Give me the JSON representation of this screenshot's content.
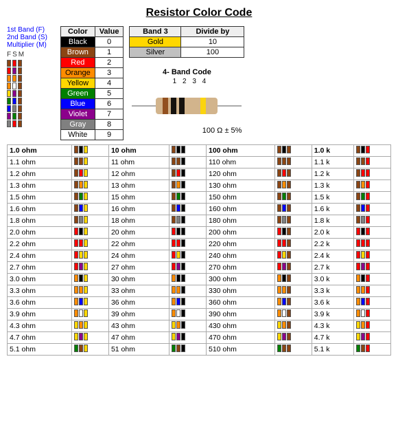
{
  "title": "Resistor Color Code",
  "legend": {
    "line1": "1st Band (F)",
    "line2": "2nd Band (S)",
    "line3": "Multiplier (M)",
    "fsm_labels": "F  S  M"
  },
  "color_table": {
    "headers": [
      "Color",
      "Value"
    ],
    "rows": [
      {
        "name": "Black",
        "value": "0",
        "cls": "color-name-black"
      },
      {
        "name": "Brown",
        "value": "1",
        "cls": "color-name-brown"
      },
      {
        "name": "Red",
        "value": "2",
        "cls": "color-name-red"
      },
      {
        "name": "Orange",
        "value": "3",
        "cls": "color-name-orange"
      },
      {
        "name": "Yellow",
        "value": "4",
        "cls": "color-name-yellow"
      },
      {
        "name": "Green",
        "value": "5",
        "cls": "color-name-green"
      },
      {
        "name": "Blue",
        "value": "6",
        "cls": "color-name-blue"
      },
      {
        "name": "Violet",
        "value": "7",
        "cls": "color-name-violet"
      },
      {
        "name": "Gray",
        "value": "8",
        "cls": "color-name-gray"
      },
      {
        "name": "White",
        "value": "9",
        "cls": "color-name-white"
      }
    ]
  },
  "band3_table": {
    "headers": [
      "Band 3",
      "Divide by"
    ],
    "rows": [
      {
        "name": "Gold",
        "value": "10",
        "cls": "color-name-gold"
      },
      {
        "name": "Silver",
        "value": "100",
        "cls": "color-name-silver"
      }
    ]
  },
  "diagram": {
    "title": "4- Band Code",
    "label": "100 Ω ± 5%",
    "band_numbers": "1 2 3  4"
  },
  "main_table": {
    "rows": [
      {
        "val": "1.0 ohm",
        "b1": "brown",
        "b2": "black",
        "b3": "gold",
        "val2": "10 ohm",
        "b21": "brown",
        "b22": "black",
        "b23": "black",
        "val3": "100 ohm",
        "b31": "brown",
        "b32": "black",
        "b33": "brown",
        "val4": "1.0 k",
        "b41": "brown",
        "b42": "black",
        "b43": "red",
        "bold": true
      },
      {
        "val": "1.1 ohm",
        "b1": "brown",
        "b2": "brown",
        "b3": "gold",
        "val2": "11 ohm",
        "b21": "brown",
        "b22": "brown",
        "b23": "black",
        "val3": "110 ohm",
        "b31": "brown",
        "b32": "brown",
        "b33": "brown",
        "val4": "1.1 k",
        "b41": "brown",
        "b42": "brown",
        "b43": "red"
      },
      {
        "val": "1.2 ohm",
        "b1": "brown",
        "b2": "red",
        "b3": "gold",
        "val2": "12 ohm",
        "b21": "brown",
        "b22": "red",
        "b23": "black",
        "val3": "120 ohm",
        "b31": "brown",
        "b32": "red",
        "b33": "brown",
        "val4": "1.2 k",
        "b41": "brown",
        "b42": "red",
        "b43": "red"
      },
      {
        "val": "1.3 ohm",
        "b1": "brown",
        "b2": "orange",
        "b3": "gold",
        "val2": "13 ohm",
        "b21": "brown",
        "b22": "orange",
        "b23": "black",
        "val3": "130 ohm",
        "b31": "brown",
        "b32": "orange",
        "b33": "brown",
        "val4": "1.3 k",
        "b41": "brown",
        "b42": "orange",
        "b43": "red"
      },
      {
        "val": "1.5 ohm",
        "b1": "brown",
        "b2": "green",
        "b3": "gold",
        "val2": "15 ohm",
        "b21": "brown",
        "b22": "green",
        "b23": "black",
        "val3": "150 ohm",
        "b31": "brown",
        "b32": "green",
        "b33": "brown",
        "val4": "1.5 k",
        "b41": "brown",
        "b42": "green",
        "b43": "red"
      },
      {
        "val": "1.6 ohm",
        "b1": "brown",
        "b2": "blue",
        "b3": "gold",
        "val2": "16 ohm",
        "b21": "brown",
        "b22": "blue",
        "b23": "black",
        "val3": "160 ohm",
        "b31": "brown",
        "b32": "blue",
        "b33": "brown",
        "val4": "1.6 k",
        "b41": "brown",
        "b42": "blue",
        "b43": "red"
      },
      {
        "val": "1.8 ohm",
        "b1": "brown",
        "b2": "gray",
        "b3": "gold",
        "val2": "18 ohm",
        "b21": "brown",
        "b22": "gray",
        "b23": "black",
        "val3": "180 ohm",
        "b31": "brown",
        "b32": "gray",
        "b33": "brown",
        "val4": "1.8 k",
        "b41": "brown",
        "b42": "gray",
        "b43": "red"
      },
      {
        "val": "2.0 ohm",
        "b1": "red",
        "b2": "black",
        "b3": "gold",
        "val2": "20 ohm",
        "b21": "red",
        "b22": "black",
        "b23": "black",
        "val3": "200 ohm",
        "b31": "red",
        "b32": "black",
        "b33": "brown",
        "val4": "2.0 k",
        "b41": "red",
        "b42": "black",
        "b43": "red"
      },
      {
        "val": "2.2 ohm",
        "b1": "red",
        "b2": "red",
        "b3": "gold",
        "val2": "22 ohm",
        "b21": "red",
        "b22": "red",
        "b23": "black",
        "val3": "220 ohm",
        "b31": "red",
        "b32": "red",
        "b33": "brown",
        "val4": "2.2 k",
        "b41": "red",
        "b42": "red",
        "b43": "red"
      },
      {
        "val": "2.4 ohm",
        "b1": "red",
        "b2": "yellow",
        "b3": "gold",
        "val2": "24 ohm",
        "b21": "red",
        "b22": "yellow",
        "b23": "black",
        "val3": "240 ohm",
        "b31": "red",
        "b32": "yellow",
        "b33": "brown",
        "val4": "2.4 k",
        "b41": "red",
        "b42": "yellow",
        "b43": "red"
      },
      {
        "val": "2.7 ohm",
        "b1": "red",
        "b2": "violet",
        "b3": "gold",
        "val2": "27 ohm",
        "b21": "red",
        "b22": "violet",
        "b23": "black",
        "val3": "270 ohm",
        "b31": "red",
        "b32": "violet",
        "b33": "brown",
        "val4": "2.7 k",
        "b41": "red",
        "b42": "violet",
        "b43": "red"
      },
      {
        "val": "3.0 ohm",
        "b1": "orange",
        "b2": "black",
        "b3": "gold",
        "val2": "30 ohm",
        "b21": "orange",
        "b22": "black",
        "b23": "black",
        "val3": "300 ohm",
        "b31": "orange",
        "b32": "black",
        "b33": "brown",
        "val4": "3.0 k",
        "b41": "orange",
        "b42": "black",
        "b43": "red"
      },
      {
        "val": "3.3 ohm",
        "b1": "orange",
        "b2": "orange",
        "b3": "gold",
        "val2": "33 ohm",
        "b21": "orange",
        "b22": "orange",
        "b23": "black",
        "val3": "330 ohm",
        "b31": "orange",
        "b32": "orange",
        "b33": "brown",
        "val4": "3.3 k",
        "b41": "orange",
        "b42": "orange",
        "b43": "red"
      },
      {
        "val": "3.6 ohm",
        "b1": "orange",
        "b2": "blue",
        "b3": "gold",
        "val2": "36 ohm",
        "b21": "orange",
        "b22": "blue",
        "b23": "black",
        "val3": "360 ohm",
        "b31": "orange",
        "b32": "blue",
        "b33": "brown",
        "val4": "3.6 k",
        "b41": "orange",
        "b42": "blue",
        "b43": "red"
      },
      {
        "val": "3.9 ohm",
        "b1": "orange",
        "b2": "white",
        "b3": "gold",
        "val2": "39 ohm",
        "b21": "orange",
        "b22": "white",
        "b23": "black",
        "val3": "390 ohm",
        "b31": "orange",
        "b32": "white",
        "b33": "brown",
        "val4": "3.9 k",
        "b41": "orange",
        "b42": "white",
        "b43": "red"
      },
      {
        "val": "4.3 ohm",
        "b1": "yellow",
        "b2": "orange",
        "b3": "gold",
        "val2": "43 ohm",
        "b21": "yellow",
        "b22": "orange",
        "b23": "black",
        "val3": "430 ohm",
        "b31": "yellow",
        "b32": "orange",
        "b33": "brown",
        "val4": "4.3 k",
        "b41": "yellow",
        "b42": "orange",
        "b43": "red"
      },
      {
        "val": "4.7 ohm",
        "b1": "yellow",
        "b2": "violet",
        "b3": "gold",
        "val2": "47 ohm",
        "b21": "yellow",
        "b22": "violet",
        "b23": "black",
        "val3": "470 ohm",
        "b31": "yellow",
        "b32": "violet",
        "b33": "brown",
        "val4": "4.7 k",
        "b41": "yellow",
        "b42": "violet",
        "b43": "red"
      },
      {
        "val": "5.1 ohm",
        "b1": "green",
        "b2": "brown",
        "b3": "gold",
        "val2": "51 ohm",
        "b21": "green",
        "b22": "brown",
        "b23": "black",
        "val3": "510 ohm",
        "b31": "green",
        "b32": "brown",
        "b33": "brown",
        "val4": "5.1 k",
        "b41": "green",
        "b42": "brown",
        "b43": "red"
      }
    ]
  },
  "colors": {
    "black": "#000000",
    "brown": "#8B4513",
    "red": "#FF0000",
    "orange": "#FF8C00",
    "yellow": "#FFD700",
    "green": "#008000",
    "blue": "#0000FF",
    "violet": "#8B008B",
    "gray": "#808080",
    "white": "#FFFFFF",
    "gold": "#FFD700",
    "silver": "#C0C0C0"
  }
}
